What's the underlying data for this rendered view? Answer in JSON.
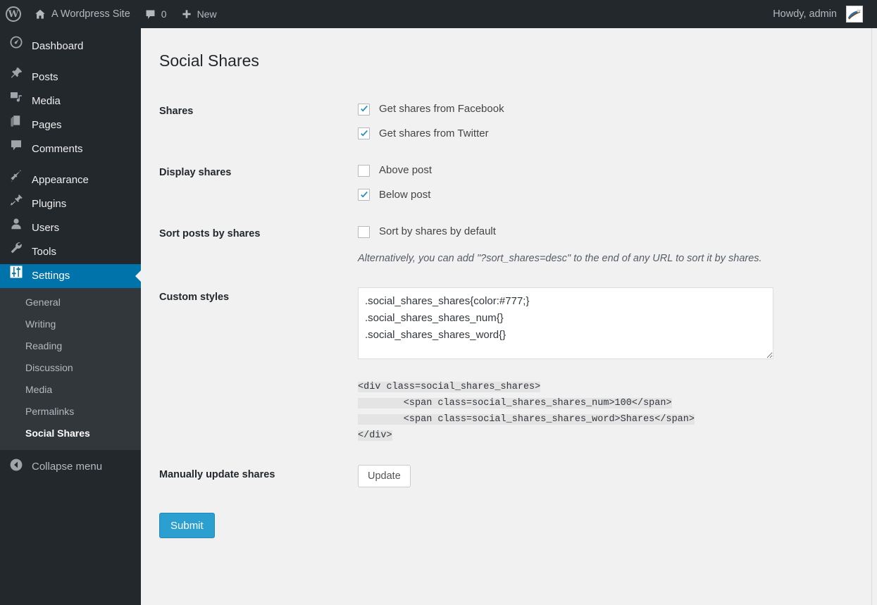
{
  "adminbar": {
    "wp_logo_letter": "W",
    "site_name": "A Wordpress Site",
    "comments_count": "0",
    "new_label": "New",
    "howdy": "Howdy, admin",
    "icons": {
      "wp": "wordpress-logo-icon",
      "home": "house-icon",
      "comments": "comment-bubble-icon",
      "new": "plus-icon",
      "avatar": "avatar-icon"
    }
  },
  "sidebar": {
    "items": [
      {
        "label": "Dashboard",
        "icon": "dashboard-icon",
        "current": false
      },
      {
        "label": "Posts",
        "icon": "pin-icon",
        "current": false
      },
      {
        "label": "Media",
        "icon": "media-icon",
        "current": false
      },
      {
        "label": "Pages",
        "icon": "pages-icon",
        "current": false
      },
      {
        "label": "Comments",
        "icon": "comment-bubble-icon",
        "current": false
      },
      {
        "label": "Appearance",
        "icon": "paintbrush-icon",
        "current": false
      },
      {
        "label": "Plugins",
        "icon": "plug-icon",
        "current": false
      },
      {
        "label": "Users",
        "icon": "user-icon",
        "current": false
      },
      {
        "label": "Tools",
        "icon": "wrench-icon",
        "current": false
      },
      {
        "label": "Settings",
        "icon": "settings-sliders-icon",
        "current": true
      }
    ],
    "submenu": [
      {
        "label": "General",
        "current": false
      },
      {
        "label": "Writing",
        "current": false
      },
      {
        "label": "Reading",
        "current": false
      },
      {
        "label": "Discussion",
        "current": false
      },
      {
        "label": "Media",
        "current": false
      },
      {
        "label": "Permalinks",
        "current": false
      },
      {
        "label": "Social Shares",
        "current": true
      }
    ],
    "collapse_label": "Collapse menu",
    "collapse_icon": "chevron-left-circle-icon"
  },
  "page": {
    "title": "Social Shares"
  },
  "form": {
    "shares": {
      "label": "Shares",
      "options": [
        {
          "label": "Get shares from Facebook",
          "checked": true
        },
        {
          "label": "Get shares from Twitter",
          "checked": true
        }
      ]
    },
    "display_shares": {
      "label": "Display shares",
      "options": [
        {
          "label": "Above post",
          "checked": false
        },
        {
          "label": "Below post",
          "checked": true
        }
      ]
    },
    "sort_posts": {
      "label": "Sort posts by shares",
      "options": [
        {
          "label": "Sort by shares by default",
          "checked": false
        }
      ],
      "description": "Alternatively, you can add \"?sort_shares=desc\" to the end of any URL to sort it by shares."
    },
    "custom_styles": {
      "label": "Custom styles",
      "value": ".social_shares_shares{color:#777;}\n.social_shares_shares_num{}\n.social_shares_shares_word{}",
      "code_sample_lines": [
        "<div class=social_shares_shares>",
        "        <span class=social_shares_shares_num>100</span>",
        "        <span class=social_shares_shares_word>Shares</span>",
        "</div>"
      ]
    },
    "manual_update": {
      "label": "Manually update shares",
      "button_label": "Update"
    },
    "submit_label": "Submit"
  },
  "colors": {
    "admin_bar_bg": "#23282d",
    "sidebar_bg": "#23282d",
    "submenu_bg": "#32373c",
    "active_menu_bg": "#0073aa",
    "content_bg": "#f1f1f1",
    "primary_button": "#2b9fd0",
    "checkbox_check": "#1e8cbe",
    "code_highlight": "#e4e4e4"
  }
}
